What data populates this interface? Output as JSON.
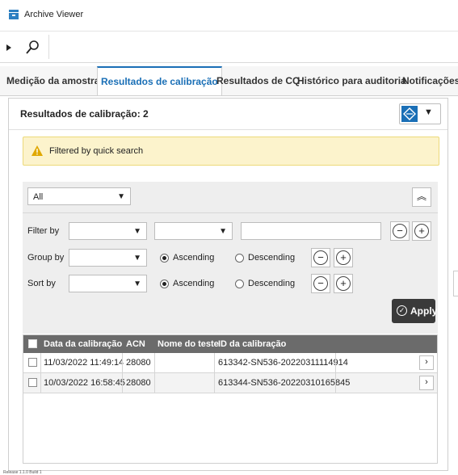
{
  "window": {
    "title": "Archive Viewer"
  },
  "toolbar": {
    "expand_icon": "play-arrow-icon",
    "search_icon": "search-icon"
  },
  "tabs": [
    {
      "label": "Medição da amostra",
      "active": false
    },
    {
      "label": "Resultados de calibração",
      "active": true
    },
    {
      "label": "Resultados de CQ",
      "active": false
    },
    {
      "label": "Histórico para auditoria",
      "active": false
    },
    {
      "label": "Notificações",
      "active": false
    }
  ],
  "panel": {
    "title": "Resultados de calibração: 2",
    "menu_icon": "diamond-arrows-icon",
    "banner": {
      "text": "Filtered by quick search",
      "icon": "warning-icon"
    }
  },
  "filters": {
    "scope": {
      "value": "All"
    },
    "filter_by": {
      "label": "Filter by"
    },
    "group_by": {
      "label": "Group by",
      "asc": "Ascending",
      "desc": "Descending",
      "selected": "Ascending"
    },
    "sort_by": {
      "label": "Sort by",
      "asc": "Ascending",
      "desc": "Descending",
      "selected": "Ascending"
    },
    "apply": {
      "label": "Apply"
    }
  },
  "table": {
    "columns": [
      "Data da calibração",
      "ACN",
      "Nome do teste",
      "ID da calibração"
    ],
    "rows": [
      {
        "date": "11/03/2022 11:49:14",
        "acn": "28080",
        "test": "",
        "id": "613342-SN536-20220311114914"
      },
      {
        "date": "10/03/2022 16:58:45",
        "acn": "28080",
        "test": "",
        "id": "613344-SN536-20220310165845"
      }
    ]
  },
  "statusbar": {
    "text": "Release 1.1.0 Build 1"
  },
  "colors": {
    "accent": "#1a6fb6",
    "banner": "#fcf3cc",
    "header": "#6b6b6b",
    "apply": "#3a3a3a"
  }
}
